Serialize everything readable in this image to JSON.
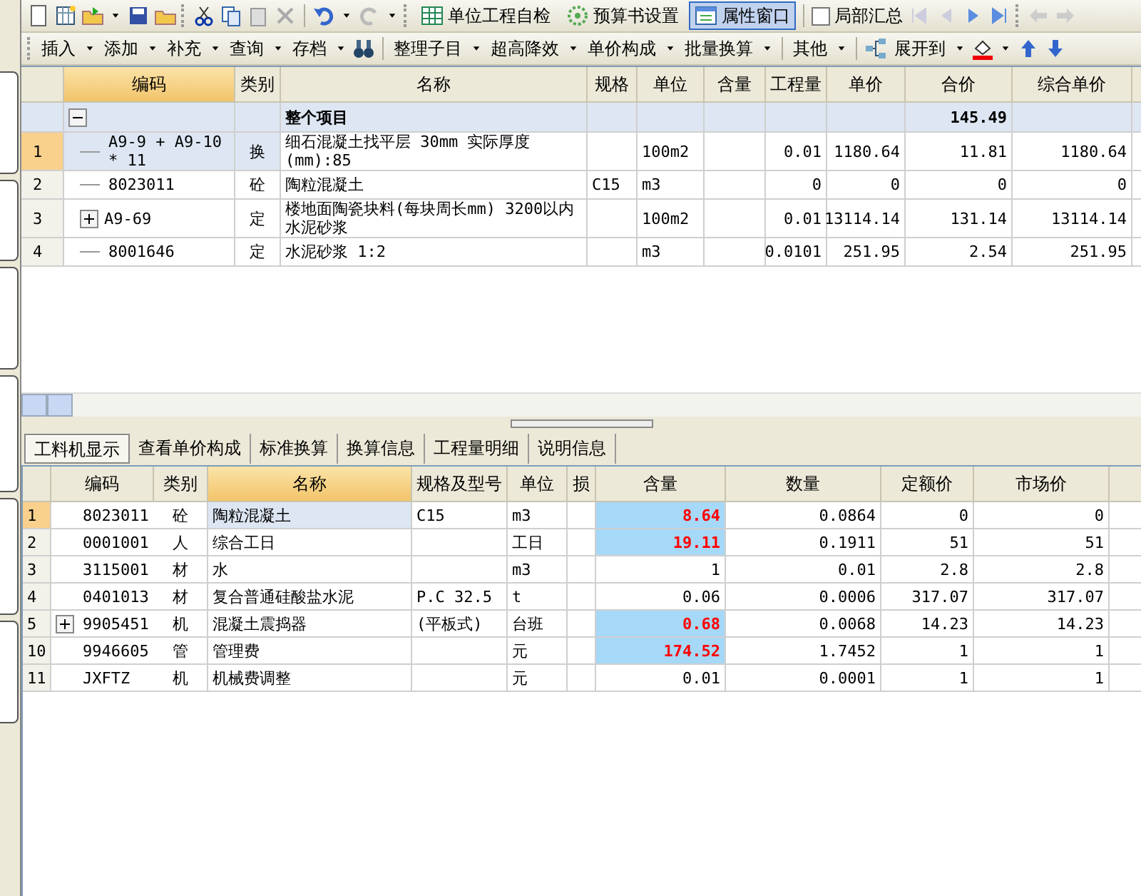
{
  "toolbar_main": {
    "buttons": [
      {
        "label": "单位工程自检",
        "selected": false
      },
      {
        "label": "预算书设置",
        "selected": false
      },
      {
        "label": "属性窗口",
        "selected": true
      }
    ],
    "checkbox": {
      "label": "局部汇总",
      "checked": false
    }
  },
  "toolbar_edit": {
    "menus": [
      "插入",
      "添加",
      "补充",
      "查询",
      "存档"
    ],
    "menus_2": [
      "整理子目",
      "超高降效",
      "单价构成",
      "批量换算"
    ],
    "menus_3": [
      "其他"
    ],
    "expand_label": "展开到"
  },
  "top_grid": {
    "columns": [
      {
        "label": "编码",
        "selected": true
      },
      {
        "label": "类别",
        "selected": false
      },
      {
        "label": "名称",
        "selected": false
      },
      {
        "label": "规格",
        "selected": false
      },
      {
        "label": "单位",
        "selected": false
      },
      {
        "label": "含量",
        "selected": false
      },
      {
        "label": "工程量",
        "selected": false
      },
      {
        "label": "单价",
        "selected": false
      },
      {
        "label": "合价",
        "selected": false
      },
      {
        "label": "综合单价",
        "selected": false
      }
    ],
    "total_row": {
      "name": "整个项目",
      "total": "145.49",
      "expanded": true
    },
    "rows": [
      {
        "index": "1",
        "code": "A9-9 + A9-10 * 11",
        "type": "换",
        "name": "细石混凝土找平层 30mm 实际厚度(mm):85",
        "spec": "",
        "unit": "100m2",
        "content": "",
        "quantity": "0.01",
        "unit_price": "1180.64",
        "total": "11.81",
        "composite_price": "1180.64",
        "selected": true,
        "expandable": false
      },
      {
        "index": "2",
        "code": "8023011",
        "type": "砼",
        "name": "陶粒混凝土",
        "spec": "C15",
        "unit": "m3",
        "content": "",
        "quantity": "0",
        "unit_price": "0",
        "total": "0",
        "composite_price": "0",
        "selected": false,
        "expandable": false
      },
      {
        "index": "3",
        "code": "A9-69",
        "type": "定",
        "name": "楼地面陶瓷块料(每块周长mm) 3200以内水泥砂浆",
        "spec": "",
        "unit": "100m2",
        "content": "",
        "quantity": "0.01",
        "unit_price": "13114.14",
        "total": "131.14",
        "composite_price": "13114.14",
        "selected": false,
        "expandable": true
      },
      {
        "index": "4",
        "code": "8001646",
        "type": "定",
        "name": "水泥砂浆 1:2",
        "spec": "",
        "unit": "m3",
        "content": "",
        "quantity": "0.0101",
        "unit_price": "251.95",
        "total": "2.54",
        "composite_price": "251.95",
        "selected": false,
        "expandable": false
      }
    ]
  },
  "bottom_tabs": [
    {
      "label": "工料机显示",
      "selected": true
    },
    {
      "label": "查看单价构成",
      "selected": false
    },
    {
      "label": "标准换算",
      "selected": false
    },
    {
      "label": "换算信息",
      "selected": false
    },
    {
      "label": "工程量明细",
      "selected": false
    },
    {
      "label": "说明信息",
      "selected": false
    }
  ],
  "bottom_grid": {
    "columns": [
      {
        "label": "编码",
        "selected": false
      },
      {
        "label": "类别",
        "selected": false
      },
      {
        "label": "名称",
        "selected": true
      },
      {
        "label": "规格及型号",
        "selected": false
      },
      {
        "label": "单位",
        "selected": false
      },
      {
        "label": "损",
        "selected": false
      },
      {
        "label": "含量",
        "selected": false
      },
      {
        "label": "数量",
        "selected": false
      },
      {
        "label": "定额价",
        "selected": false
      },
      {
        "label": "市场价",
        "selected": false
      }
    ],
    "rows": [
      {
        "index": "1",
        "code": "8023011",
        "type": "砼",
        "name": "陶粒混凝土",
        "spec": "C15",
        "unit": "m3",
        "content": "8.64",
        "amount": "0.0864",
        "quota_price": "0",
        "market_price": "0",
        "modified": true,
        "selected": true,
        "expandable": false
      },
      {
        "index": "2",
        "code": "0001001",
        "type": "人",
        "name": "综合工日",
        "spec": "",
        "unit": "工日",
        "content": "19.11",
        "amount": "0.1911",
        "quota_price": "51",
        "market_price": "51",
        "modified": true,
        "selected": false,
        "expandable": false
      },
      {
        "index": "3",
        "code": "3115001",
        "type": "材",
        "name": "水",
        "spec": "",
        "unit": "m3",
        "content": "1",
        "amount": "0.01",
        "quota_price": "2.8",
        "market_price": "2.8",
        "modified": false,
        "selected": false,
        "expandable": false
      },
      {
        "index": "4",
        "code": "0401013",
        "type": "材",
        "name": "复合普通硅酸盐水泥",
        "spec": "P.C 32.5",
        "unit": "t",
        "content": "0.06",
        "amount": "0.0006",
        "quota_price": "317.07",
        "market_price": "317.07",
        "modified": false,
        "selected": false,
        "expandable": false
      },
      {
        "index": "5",
        "code": "9905451",
        "type": "机",
        "name": "混凝土震捣器",
        "spec": "(平板式)",
        "unit": "台班",
        "content": "0.68",
        "amount": "0.0068",
        "quota_price": "14.23",
        "market_price": "14.23",
        "modified": true,
        "selected": false,
        "expandable": true
      },
      {
        "index": "10",
        "code": "9946605",
        "type": "管",
        "name": "管理费",
        "spec": "",
        "unit": "元",
        "content": "174.52",
        "amount": "1.7452",
        "quota_price": "1",
        "market_price": "1",
        "modified": true,
        "selected": false,
        "expandable": false
      },
      {
        "index": "11",
        "code": "JXFTZ",
        "type": "机",
        "name": "机械费调整",
        "spec": "",
        "unit": "元",
        "content": "0.01",
        "amount": "0.0001",
        "quota_price": "1",
        "market_price": "1",
        "modified": false,
        "selected": false,
        "expandable": false
      }
    ]
  }
}
